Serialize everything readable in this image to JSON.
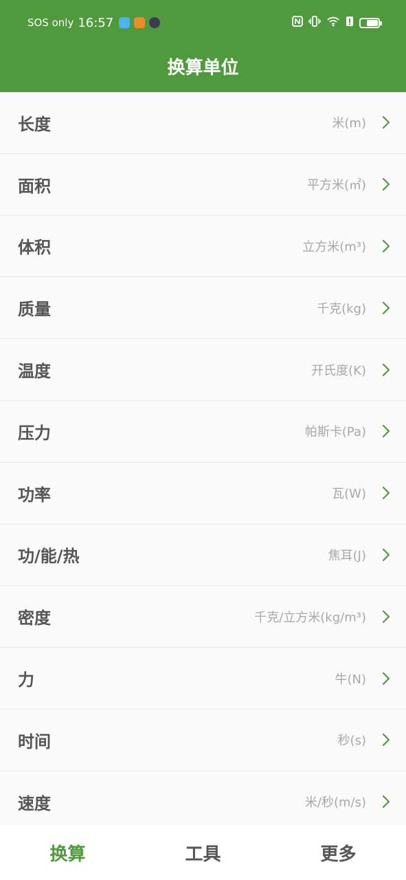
{
  "status": {
    "network": "SOS only",
    "time": "16:57",
    "signal_note": "6"
  },
  "header": {
    "title": "换算单位"
  },
  "colors": {
    "accent": "#4f9a3d",
    "chevron": "#4f9a3d",
    "text": "#555555",
    "muted": "#a8a8a8"
  },
  "units": [
    {
      "name": "长度",
      "value": "米(m)"
    },
    {
      "name": "面积",
      "value": "平方米(㎡)"
    },
    {
      "name": "体积",
      "value": "立方米(m³)"
    },
    {
      "name": "质量",
      "value": "千克(kg)"
    },
    {
      "name": "温度",
      "value": "开氏度(K)"
    },
    {
      "name": "压力",
      "value": "帕斯卡(Pa)"
    },
    {
      "name": "功率",
      "value": "瓦(W)"
    },
    {
      "name": "功/能/热",
      "value": "焦耳(J)"
    },
    {
      "name": "密度",
      "value": "千克/立方米(kg/m³)"
    },
    {
      "name": "力",
      "value": "牛(N)"
    },
    {
      "name": "时间",
      "value": "秒(s)"
    },
    {
      "name": "速度",
      "value": "米/秒(m/s)"
    }
  ],
  "tabs": [
    {
      "label": "换算",
      "active": true
    },
    {
      "label": "工具",
      "active": false
    },
    {
      "label": "更多",
      "active": false
    }
  ]
}
